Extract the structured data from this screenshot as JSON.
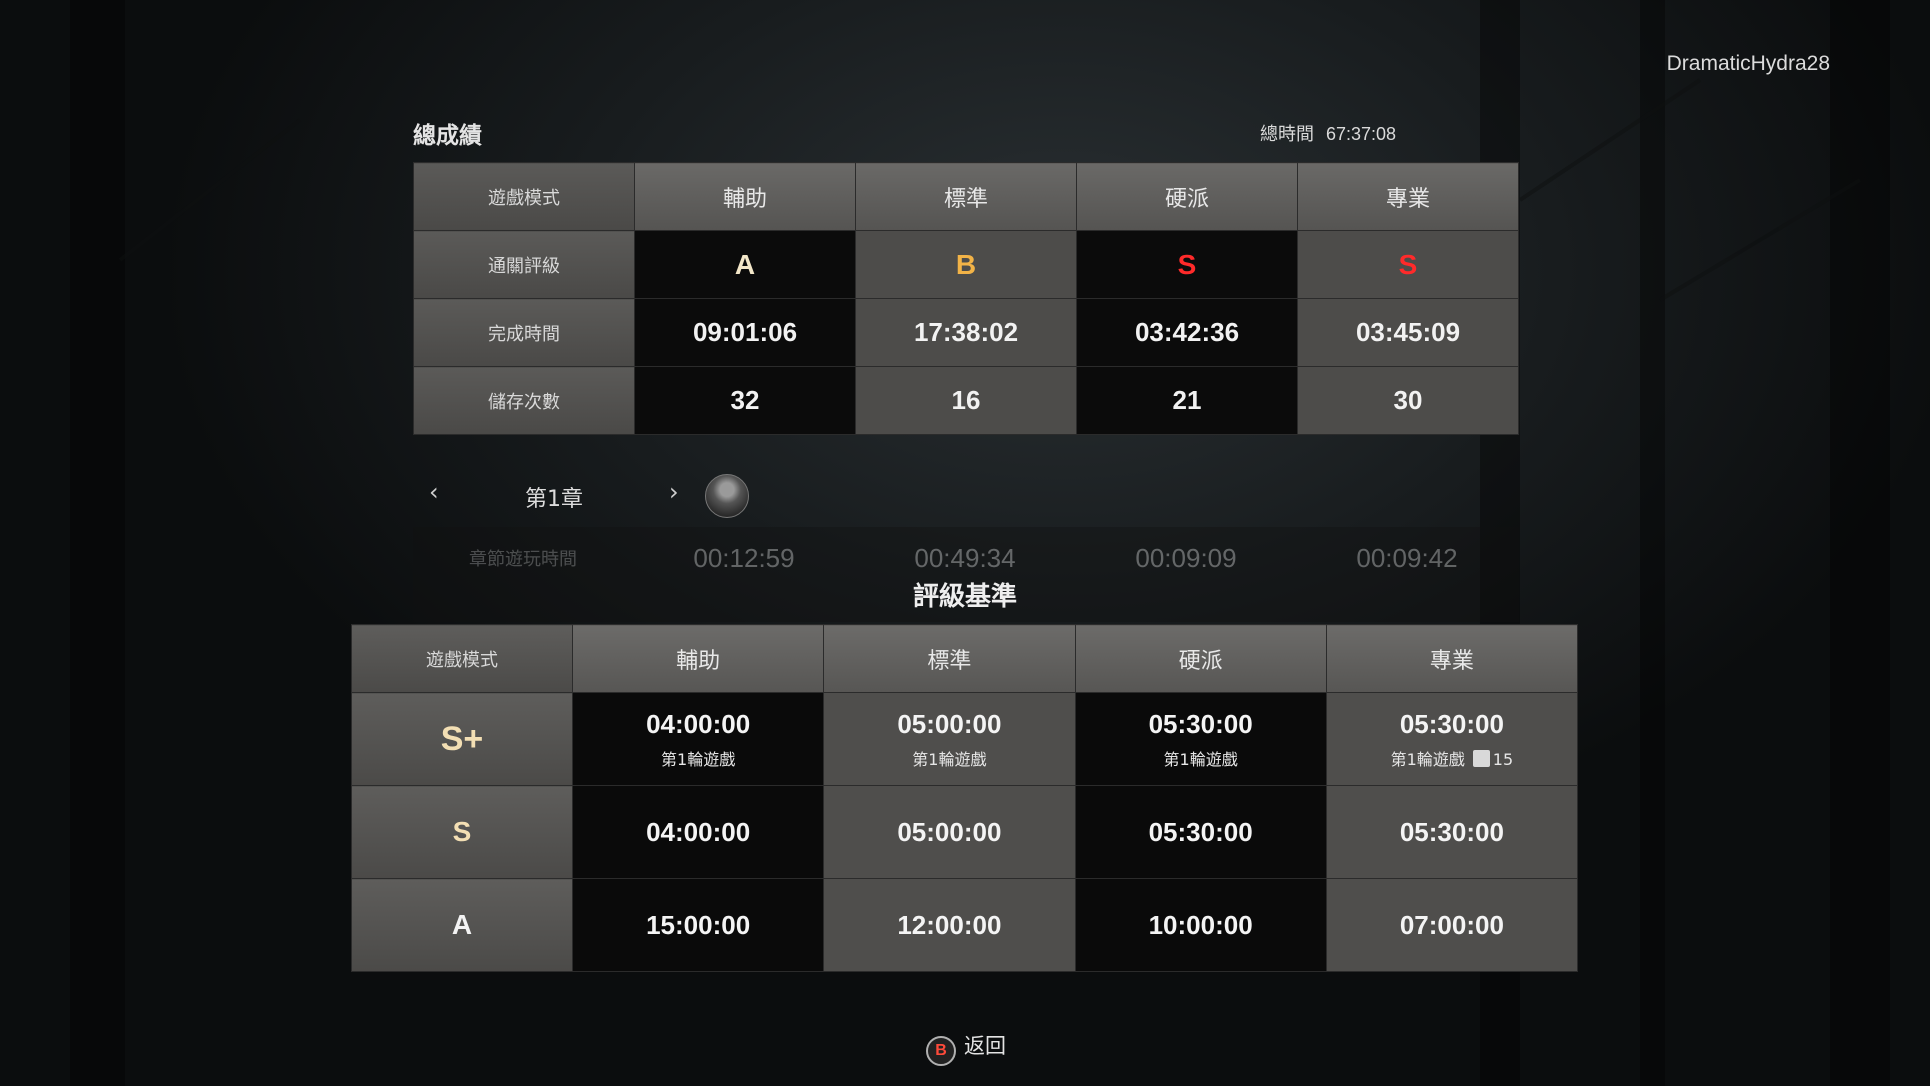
{
  "username": "DramaticHydra28",
  "summary": {
    "title": "總成績",
    "total_time_label": "總時間",
    "total_time": "67:37:08",
    "mode_header": "遊戲模式",
    "modes": [
      "輔助",
      "標準",
      "硬派",
      "專業"
    ],
    "rows": {
      "rank_label": "通關評級",
      "ranks": [
        "A",
        "B",
        "S",
        "S"
      ],
      "rank_colors": [
        "#f3e7c9",
        "#f2b347",
        "#ff2a2a",
        "#ff2a2a"
      ],
      "time_label": "完成時間",
      "times": [
        "09:01:06",
        "17:38:02",
        "03:42:36",
        "03:45:09"
      ],
      "saves_label": "儲存次數",
      "saves": [
        "32",
        "16",
        "21",
        "30"
      ]
    }
  },
  "chapter": {
    "prev_icon": "chevron-left-icon",
    "label": "第1章",
    "next_icon": "chevron-right-icon"
  },
  "chapter_stats": {
    "row_label": "章節遊玩時間",
    "values": [
      "00:12:59",
      "00:49:34",
      "00:09:09",
      "00:09:42"
    ]
  },
  "criteria": {
    "title": "評級基準",
    "mode_header": "遊戲模式",
    "modes": [
      "輔助",
      "標準",
      "硬派",
      "專業"
    ],
    "rows": [
      {
        "rank": "S+",
        "times": [
          "04:00:00",
          "05:00:00",
          "05:30:00",
          "05:30:00"
        ],
        "notes": [
          "第1輪遊戲",
          "第1輪遊戲",
          "第1輪遊戲",
          "第1輪遊戲"
        ],
        "save_limit": "15"
      },
      {
        "rank": "S",
        "times": [
          "04:00:00",
          "05:00:00",
          "05:30:00",
          "05:30:00"
        ]
      },
      {
        "rank": "A",
        "times": [
          "15:00:00",
          "12:00:00",
          "10:00:00",
          "07:00:00"
        ]
      }
    ]
  },
  "footer": {
    "button_glyph": "B",
    "back_label": "返回"
  }
}
